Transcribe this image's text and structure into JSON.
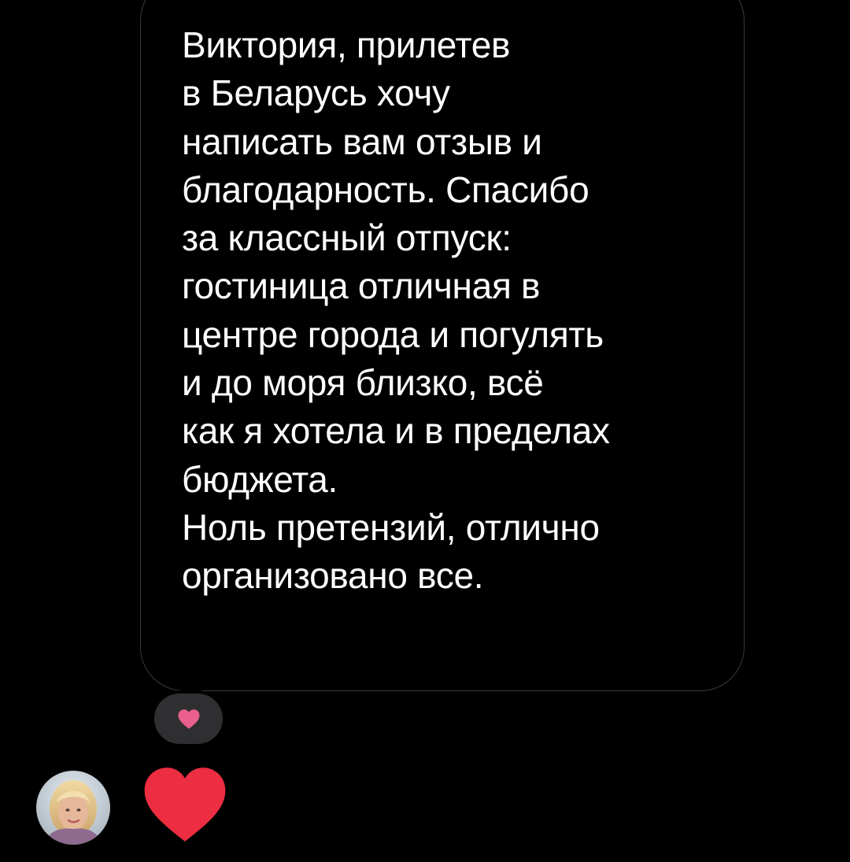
{
  "message": {
    "lines": [
      "Виктория, прилетев",
      "в Беларусь хочу",
      "написать вам отзыв и",
      "благодарность. Спасибо",
      "за классный отпуск:",
      "гостиница отличная в",
      "центре города и погулять",
      "и до моря близко, всё",
      "как я хотела и в пределах",
      "бюджета.",
      "Ноль претензий, отлично",
      "организовано все."
    ]
  },
  "reaction": {
    "icon": "heart-icon",
    "color": "#e9608e"
  },
  "reply": {
    "icon": "heart-icon",
    "color": "#ed2d41"
  },
  "avatar": {
    "icon": "user-avatar"
  },
  "colors": {
    "background": "#000000",
    "bubble_border": "#3a3a3c",
    "text": "#ffffff",
    "reaction_chip": "#2f2f31"
  }
}
